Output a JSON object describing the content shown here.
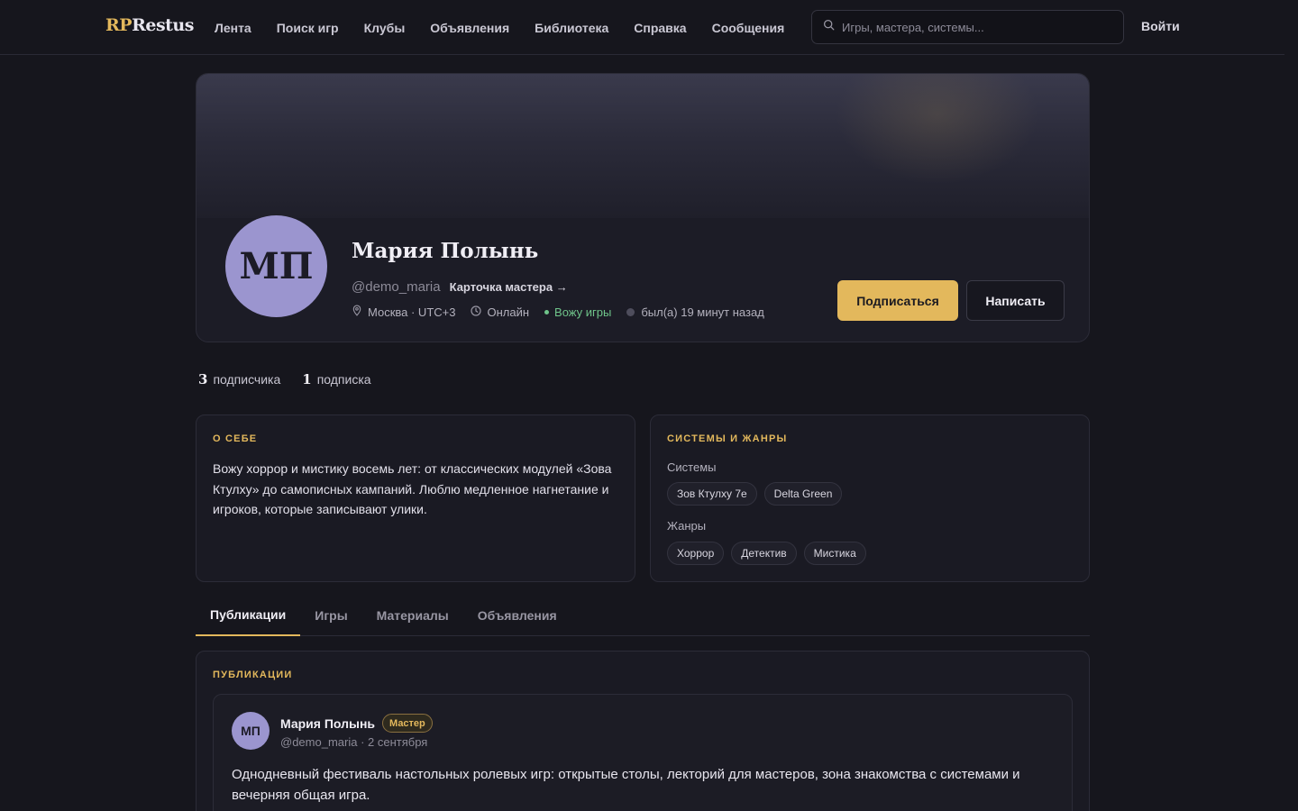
{
  "header": {
    "logo_rp": "RP",
    "logo_rest": "Restus",
    "nav": [
      "Лента",
      "Поиск игр",
      "Клубы",
      "Объявления",
      "Библиотека",
      "Справка",
      "Сообщения"
    ],
    "search_placeholder": "Игры, мастера, системы...",
    "login_label": "Войти"
  },
  "profile": {
    "initials": "МП",
    "name": "Мария Полынь",
    "handle": "@demo_maria",
    "master_card_link": "Карточка мастера →",
    "location": "Москва · UTC+3",
    "format": "Онлайн",
    "status_gm": "Вожу игры",
    "last_seen": "был(а) 19 минут назад",
    "subscribe_label": "Подписаться",
    "message_label": "Написать"
  },
  "follow": {
    "followers_count": "3",
    "followers_label": "подписчика",
    "following_count": "1",
    "following_label": "подписка"
  },
  "about": {
    "title": "О СЕБЕ",
    "text": "Вожу хоррор и мистику восемь лет: от классических модулей «Зова Ктулху» до самописных кампаний. Люблю медленное нагнетание и игроков, которые записывают улики."
  },
  "systems_genres": {
    "title": "СИСТЕМЫ И ЖАНРЫ",
    "systems_label": "Системы",
    "systems": [
      "Зов Ктулху 7e",
      "Delta Green"
    ],
    "genres_label": "Жанры",
    "genres": [
      "Хоррор",
      "Детектив",
      "Мистика"
    ]
  },
  "tabs": [
    "Публикации",
    "Игры",
    "Материалы",
    "Объявления"
  ],
  "publications": {
    "title": "ПУБЛИКАЦИИ",
    "post": {
      "initials": "МП",
      "author": "Мария Полынь",
      "badge": "Мастер",
      "meta": "@demo_maria · 2 сентября",
      "text": "Однодневный фестиваль настольных ролевых игр: открытые столы, лекторий для мастеров, зона знакомства с системами и вечерняя общая игра."
    }
  },
  "colors": {
    "background": "#16161d",
    "accent": "#e3b85c",
    "avatar": "#9b95cf",
    "online_green": "#6fc48a"
  }
}
